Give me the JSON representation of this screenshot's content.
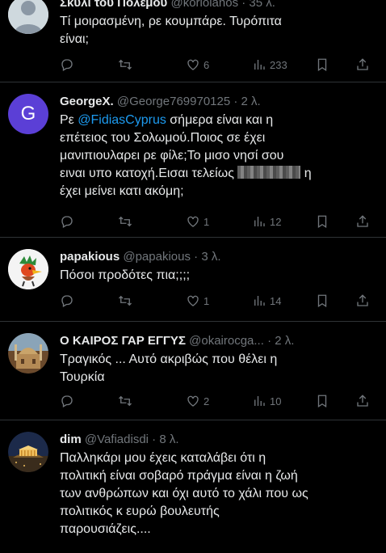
{
  "tweets": [
    {
      "name": "Σκυλί του Πολέμου",
      "handle": "@koriolanos",
      "time": "35 λ.",
      "text_lines": [
        "Τί μοιρασμένη, ρε κουμπάρε. Τυρόπιτα",
        "είναι;"
      ],
      "counts": {
        "reply": "",
        "retweet": "",
        "like": "6",
        "views": "233"
      }
    },
    {
      "name": "GeorgeX.",
      "handle": "@George769970125",
      "time": "2 λ.",
      "avatar_letter": "G",
      "text_lines": [
        {
          "pre": "Ρε ",
          "mention": "@FidiasCyprus",
          "post": " σήμερα είναι και η"
        },
        "επέτειος του Σολωμού.Ποιος σε έχει",
        "μανιπιουλαρει ρε φίλε;Το μισο νησί σου",
        {
          "pre": "ειναι υπο κατοχή.Εισαι τελείως ",
          "post": " η"
        },
        "έχει μείνει κατι ακόμη;"
      ],
      "counts": {
        "reply": "",
        "retweet": "",
        "like": "1",
        "views": "12"
      }
    },
    {
      "name": "papakious",
      "handle": "@papakious",
      "time": "3 λ.",
      "text_lines": [
        "Πόσοι προδότες πια;;;;"
      ],
      "counts": {
        "reply": "",
        "retweet": "",
        "like": "1",
        "views": "14"
      }
    },
    {
      "name": "Ο ΚΑΙΡΟΣ ΓΑΡ ΕΓΓΥΣ",
      "handle": "@okairocga...",
      "time": "2 λ.",
      "text_lines": [
        "Τραγικός ... Αυτό ακριβώς που θέλει η",
        "Τουρκία"
      ],
      "counts": {
        "reply": "",
        "retweet": "",
        "like": "2",
        "views": "10"
      }
    },
    {
      "name": "dim",
      "handle": "@Vafiadisdi",
      "time": "8 λ.",
      "text_lines": [
        "Παλληκάρι μου έχεις καταλάβει ότι η",
        "πολιτική είναι σοβαρό πράγμα είναι η ζωή",
        "των ανθρώπων και όχι αυτό το χάλι που ως",
        "πολιτικός κ ευρώ βουλευτής",
        "παρουσιάζεις...."
      ]
    }
  ],
  "colors": {
    "background": "#000000",
    "text": "#e7e9ea",
    "muted": "#71767b",
    "link": "#1d9bf0",
    "divider": "#2f3336",
    "avatar_g": "#5b3fd6"
  }
}
